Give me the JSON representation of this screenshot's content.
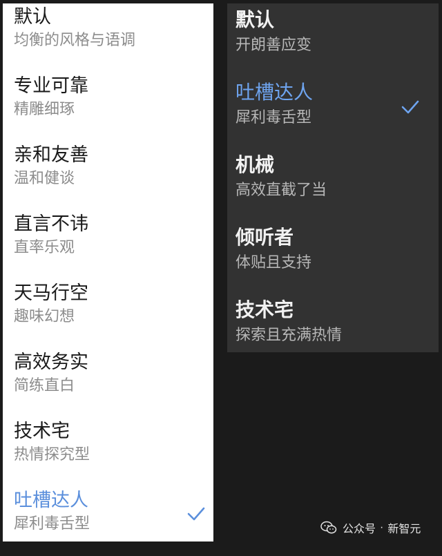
{
  "light_menu": {
    "items": [
      {
        "title": "默认",
        "subtitle": "均衡的风格与语调",
        "selected": false
      },
      {
        "title": "专业可靠",
        "subtitle": "精雕细琢",
        "selected": false
      },
      {
        "title": "亲和友善",
        "subtitle": "温和健谈",
        "selected": false
      },
      {
        "title": "直言不讳",
        "subtitle": "直率乐观",
        "selected": false
      },
      {
        "title": "天马行空",
        "subtitle": "趣味幻想",
        "selected": false
      },
      {
        "title": "高效务实",
        "subtitle": "简练直白",
        "selected": false
      },
      {
        "title": "技术宅",
        "subtitle": "热情探究型",
        "selected": false
      },
      {
        "title": "吐槽达人",
        "subtitle": "犀利毒舌型",
        "selected": true
      }
    ],
    "check_icon": "checkmark-icon",
    "accent_color": "#5b8fdc"
  },
  "dark_menu": {
    "items": [
      {
        "title": "默认",
        "subtitle": "开朗善应变",
        "selected": false
      },
      {
        "title": "吐槽达人",
        "subtitle": "犀利毒舌型",
        "selected": true
      },
      {
        "title": "机械",
        "subtitle": "高效直截了当",
        "selected": false
      },
      {
        "title": "倾听者",
        "subtitle": "体贴且支持",
        "selected": false
      },
      {
        "title": "技术宅",
        "subtitle": "探索且充满热情",
        "selected": false
      }
    ],
    "check_icon": "checkmark-icon",
    "accent_color": "#6ea4ef"
  },
  "watermark": {
    "icon": "wechat-icon",
    "source": "公众号",
    "separator": "·",
    "account": "新智元"
  }
}
